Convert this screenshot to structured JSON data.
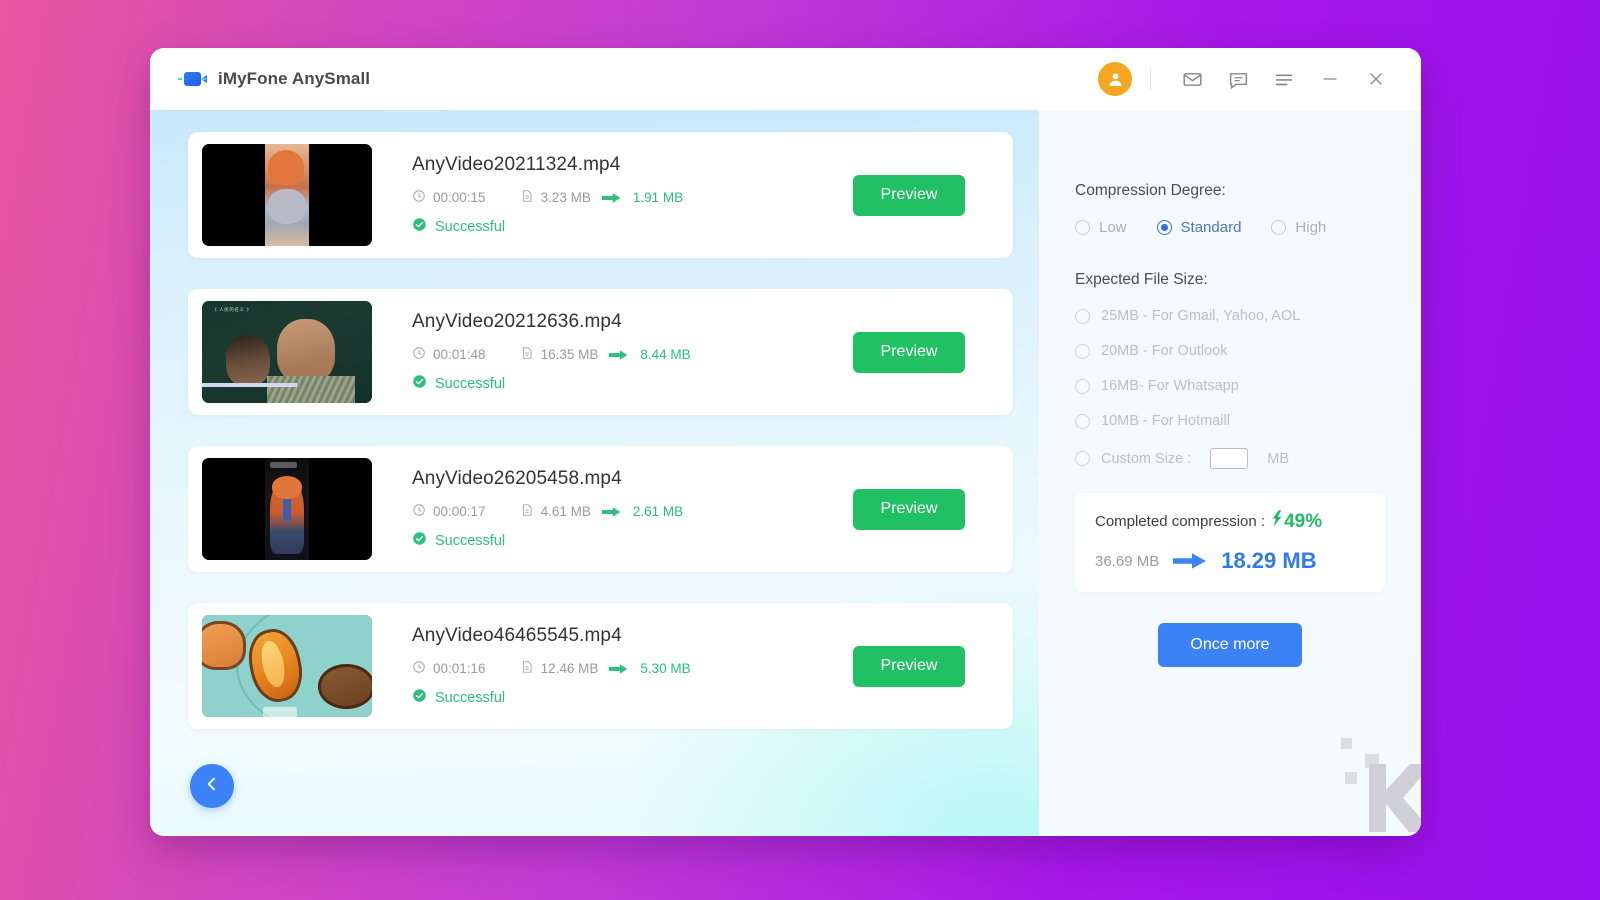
{
  "window": {
    "title": "iMyFone AnySmall",
    "logo_icon": "video-camera-icon",
    "titlebar_icons": [
      {
        "name": "avatar-icon",
        "label": "Account"
      },
      {
        "name": "mail-icon",
        "label": "Mail"
      },
      {
        "name": "feedback-icon",
        "label": "Feedback"
      },
      {
        "name": "menu-icon",
        "label": "Menu"
      },
      {
        "name": "minimize-icon",
        "label": "Minimize"
      },
      {
        "name": "close-icon",
        "label": "Close"
      }
    ]
  },
  "videos": [
    {
      "name": "AnyVideo20211324.mp4",
      "duration": "00:00:15",
      "size_in": "3.23 MB",
      "size_out": "1.91 MB",
      "status": "Successful",
      "preview_label": "Preview"
    },
    {
      "name": "AnyVideo20212636.mp4",
      "duration": "00:01:48",
      "size_in": "16.35 MB",
      "size_out": "8.44 MB",
      "status": "Successful",
      "preview_label": "Preview"
    },
    {
      "name": "AnyVideo26205458.mp4",
      "duration": "00:00:17",
      "size_in": "4.61 MB",
      "size_out": "2.61 MB",
      "status": "Successful",
      "preview_label": "Preview"
    },
    {
      "name": "AnyVideo46465545.mp4",
      "duration": "00:01:16",
      "size_in": "12.46 MB",
      "size_out": "5.30 MB",
      "status": "Successful",
      "preview_label": "Preview"
    }
  ],
  "settings": {
    "compression_label": "Compression Degree:",
    "compression_options": [
      {
        "label": "Low",
        "selected": false
      },
      {
        "label": "Standard",
        "selected": true
      },
      {
        "label": "High",
        "selected": false
      }
    ],
    "expected_size_label": "Expected File Size:",
    "size_options": [
      {
        "label": "25MB - For Gmail, Yahoo, AOL",
        "selected": false
      },
      {
        "label": "20MB - For Outlook",
        "selected": false
      },
      {
        "label": "16MB- For Whatsapp",
        "selected": false
      },
      {
        "label": "10MB - For Hotmaill",
        "selected": false
      }
    ],
    "custom_size_prefix": "Custom Size :",
    "custom_size_value": "",
    "custom_size_unit": "MB"
  },
  "result": {
    "title": "Completed compression :",
    "percent": "49%",
    "size_before": "36.69 MB",
    "size_after": "18.29 MB",
    "button_label": "Once more"
  },
  "colors": {
    "accent_blue": "#3b82f6",
    "success_green": "#22c064",
    "avatar_orange": "#f5a623",
    "radio_blue": "#2f6fe0",
    "size_after_blue": "#2f7bec"
  },
  "back_button": {
    "icon": "chevron-left-icon"
  }
}
